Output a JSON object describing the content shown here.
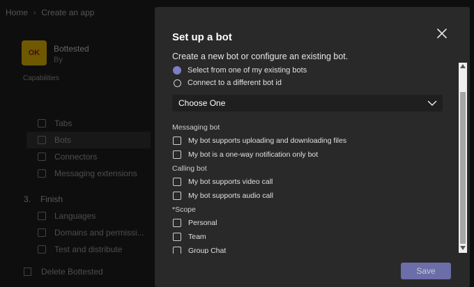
{
  "background": {
    "breadcrumb": [
      "Home",
      "Create an app"
    ],
    "app": {
      "logo_text": "OK",
      "name": "Bottested",
      "by": "By"
    },
    "capabilities_label": "Capabilities",
    "nav_items": [
      {
        "label": "Tabs",
        "icon": "tab-icon"
      },
      {
        "label": "Bots",
        "icon": "bot-icon",
        "active": true
      },
      {
        "label": "Connectors",
        "icon": "connector-icon"
      },
      {
        "label": "Messaging extensions",
        "icon": "messaging-extension-icon"
      }
    ],
    "finish_section": {
      "number": "3.",
      "label": "Finish"
    },
    "finish_items": [
      {
        "label": "Languages",
        "icon": "language-icon"
      },
      {
        "label": "Domains and permissi...",
        "icon": "globe-icon"
      },
      {
        "label": "Test and distribute",
        "icon": "test-icon"
      }
    ],
    "delete_label": "Delete Bottested"
  },
  "modal": {
    "title": "Set up a bot",
    "subtitle": "Create a new bot or configure an existing bot.",
    "radio_options": [
      {
        "label": "Select from one of my existing bots",
        "checked": true
      },
      {
        "label": "Connect to a different bot id",
        "checked": false
      }
    ],
    "dropdown": {
      "value": "Choose One"
    },
    "messaging_bot": {
      "label": "Messaging bot",
      "options": [
        "My bot supports uploading and downloading files",
        "My bot is a one-way notification only bot"
      ]
    },
    "calling_bot": {
      "label": "Calling bot",
      "options": [
        "My bot supports video call",
        "My bot supports audio call"
      ]
    },
    "scope": {
      "label": "*Scope",
      "options": [
        "Personal",
        "Team",
        "Group Chat"
      ]
    },
    "save_label": "Save"
  },
  "colors": {
    "accent": "#7b7fc4",
    "save_button": "#6b6ea8",
    "modal_bg": "#292929",
    "dropdown_bg": "#1f1f1f"
  }
}
